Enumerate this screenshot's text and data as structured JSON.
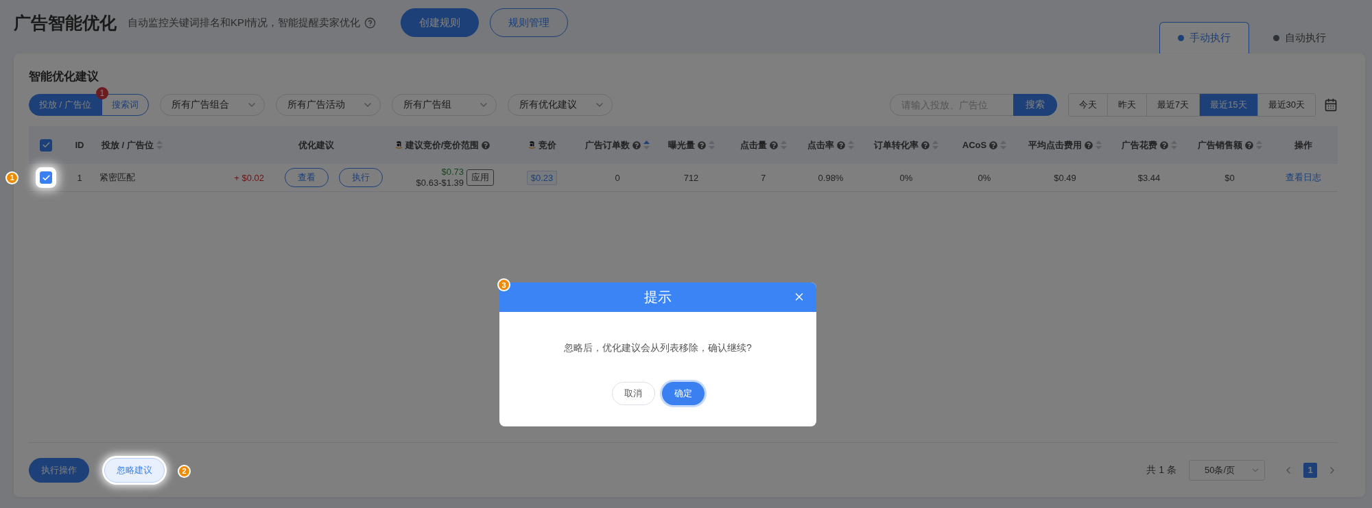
{
  "header": {
    "title": "广告智能优化",
    "subtitle": "自动监控关键词排名和KPI情况，智能提醒卖家优化",
    "buttons": [
      {
        "label": "创建规则",
        "kind": "primary"
      },
      {
        "label": "规则管理",
        "kind": "outline"
      }
    ]
  },
  "mode_tabs": [
    {
      "label": "手动执行",
      "selected": true
    },
    {
      "label": "自动执行",
      "selected": false
    }
  ],
  "panel": {
    "title": "智能优化建议"
  },
  "view_toggle": [
    {
      "label": "投放 / 广告位",
      "selected": true
    },
    {
      "label": "搜索词",
      "selected": false,
      "badge": "1"
    }
  ],
  "filters": [
    {
      "label": "所有广告组合"
    },
    {
      "label": "所有广告活动"
    },
    {
      "label": "所有广告组"
    },
    {
      "label": "所有优化建议"
    }
  ],
  "search": {
    "placeholder": "请输入投放、广告位",
    "button": "搜索"
  },
  "date_ranges": [
    {
      "label": "今天",
      "selected": false
    },
    {
      "label": "昨天",
      "selected": false
    },
    {
      "label": "最近7天",
      "selected": false
    },
    {
      "label": "最近15天",
      "selected": true
    },
    {
      "label": "最近30天",
      "selected": false
    }
  ],
  "table": {
    "all_checked": true,
    "columns": [
      {
        "label": "ID",
        "kind": "plain"
      },
      {
        "label": "投放 / 广告位",
        "kind": "plain",
        "sortable": true,
        "sorted": false
      },
      {
        "label": "优化建议",
        "kind": "plain"
      },
      {
        "label": "建议竞价/竞价范围",
        "kind": "amazon",
        "help": true
      },
      {
        "label": "竞价",
        "kind": "amazon"
      },
      {
        "label": "广告订单数",
        "kind": "plain",
        "help": true,
        "sortable": true,
        "sorted": true
      },
      {
        "label": "曝光量",
        "kind": "plain",
        "help": true,
        "sortable": true,
        "sorted": false
      },
      {
        "label": "点击量",
        "kind": "plain",
        "help": true,
        "sortable": true,
        "sorted": false
      },
      {
        "label": "点击率",
        "kind": "plain",
        "help": true,
        "sortable": true,
        "sorted": false
      },
      {
        "label": "订单转化率",
        "kind": "plain",
        "help": true,
        "sortable": true,
        "sorted": false
      },
      {
        "label": "ACoS",
        "kind": "plain",
        "help": true,
        "sortable": true,
        "sorted": false
      },
      {
        "label": "平均点击费用",
        "kind": "plain",
        "help": true,
        "sortable": true,
        "sorted": false
      },
      {
        "label": "广告花费",
        "kind": "plain",
        "help": true,
        "sortable": true,
        "sorted": false
      },
      {
        "label": "广告销售额",
        "kind": "plain",
        "help": true,
        "sortable": true,
        "sorted": false
      },
      {
        "label": "操作",
        "kind": "plain"
      }
    ],
    "rows": [
      {
        "checked": true,
        "highlighted": true,
        "step": "1",
        "id": "1",
        "target": "紧密匹配",
        "bid_change": "+ $0.02",
        "actions": [
          "查看",
          "执行"
        ],
        "suggested_bid": "$0.73",
        "bid_range": "$0.63-$1.39",
        "apply": "应用",
        "bid": "$0.23",
        "metrics": [
          "0",
          "712",
          "7",
          "0.98%",
          "0%",
          "0%",
          "$0.49",
          "$3.44",
          "$0"
        ],
        "link": "查看日志"
      }
    ]
  },
  "footer": {
    "buttons": [
      {
        "label": "执行操作",
        "kind": "primary",
        "highlighted": false
      },
      {
        "label": "忽略建议",
        "kind": "light",
        "highlighted": true,
        "step": "2"
      }
    ],
    "total": "共 1 条",
    "page_size": "50条/页",
    "pages": [
      {
        "label": "1",
        "selected": true
      }
    ]
  },
  "dialog": {
    "step": "3",
    "title": "提示",
    "message": "忽略后，优化建议会从列表移除，确认继续?",
    "buttons": [
      {
        "label": "取消",
        "kind": "default"
      },
      {
        "label": "确定",
        "kind": "primary"
      }
    ]
  }
}
